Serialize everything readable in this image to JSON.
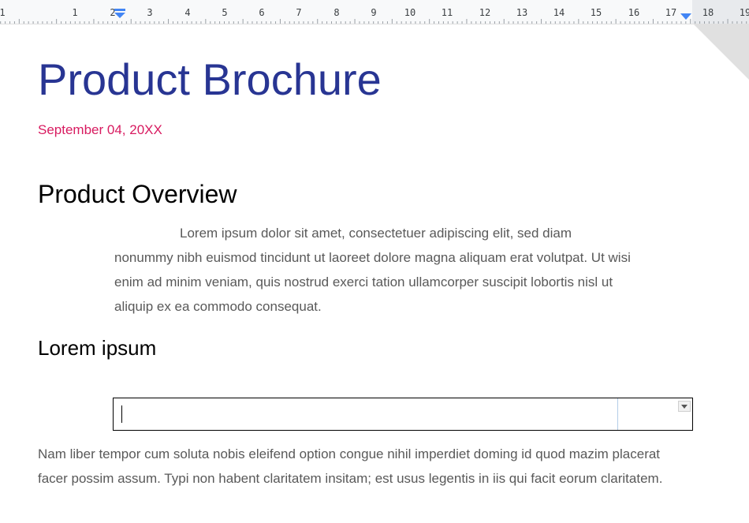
{
  "ruler": {
    "numbers": [
      "1",
      "1",
      "2",
      "3",
      "4",
      "5",
      "6",
      "7",
      "8",
      "9",
      "10",
      "11",
      "12",
      "13",
      "14",
      "15",
      "16",
      "17",
      "18",
      "19"
    ]
  },
  "document": {
    "title": "Product Brochure",
    "date": "September 04, 20XX",
    "heading1": "Product Overview",
    "overview_line1": "Lorem ipsum dolor sit amet, consectetuer adipiscing elit, sed diam",
    "overview_rest": "nonummy nibh euismod tincidunt ut laoreet dolore magna aliquam erat volutpat. Ut wisi enim ad minim veniam, quis nostrud exerci tation ullamcorper suscipit lobortis nisl ut aliquip ex ea commodo consequat.",
    "heading2": "Lorem ipsum",
    "input_value": "",
    "paragraph2": "Nam liber tempor cum soluta nobis eleifend option congue nihil imperdiet doming id quod mazim placerat facer possim assum. Typi non habent claritatem insitam; est usus legentis in iis qui facit eorum claritatem."
  },
  "colors": {
    "title": "#283593",
    "date": "#d81b60",
    "body": "#595959",
    "marker": "#4285f4"
  },
  "icons": [
    "left-indent-marker-icon",
    "right-indent-marker-icon",
    "dropdown-arrow-icon"
  ]
}
